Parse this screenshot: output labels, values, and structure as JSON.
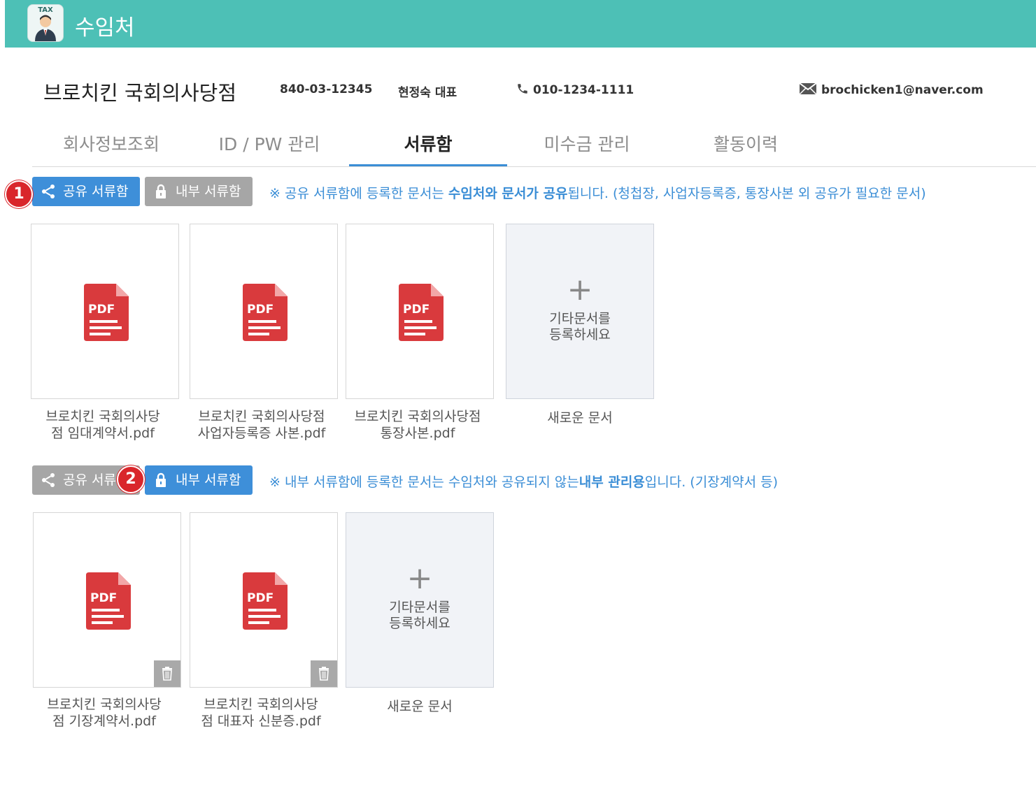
{
  "header": {
    "logo_text": "TAX",
    "title": "수임처",
    "bg_color": "#4dc0b6"
  },
  "client": {
    "company": "브로치킨 국회의사당점",
    "biz_number": "840-03-12345",
    "representative": "현정숙 대표",
    "phone": "010-1234-1111",
    "email": "brochicken1@naver.com",
    "phone_icon": "phone-icon",
    "email_icon": "envelope-icon"
  },
  "tabs": [
    {
      "label": "회사정보조회",
      "active": false
    },
    {
      "label": "ID / PW 관리",
      "active": false
    },
    {
      "label": "서류함",
      "active": true
    },
    {
      "label": "미수금 관리",
      "active": false
    },
    {
      "label": "활동이력",
      "active": false
    }
  ],
  "section1": {
    "badge": "1",
    "shared_btn": "공유 서류함",
    "internal_btn": "내부 서류함",
    "notice": {
      "p1": "※ 공유 서류함에 등록한 문서는 ",
      "b1": "수임처와 문서가 공유",
      "p2": "됩니다. (청첩장, 사업자등록증, 통장사본 외 공유가 필요한 문서)"
    },
    "files": [
      {
        "caption_l1": "브로치킨 국회의사당",
        "caption_l2": "점 임대계약서.pdf",
        "icon_label": "PDF"
      },
      {
        "caption_l1": "브로치킨 국회의사당점",
        "caption_l2": "사업자등록증 사본.pdf",
        "icon_label": "PDF"
      },
      {
        "caption_l1": "브로치킨 국회의사당점",
        "caption_l2": "통장사본.pdf",
        "icon_label": "PDF"
      }
    ],
    "new_card": {
      "plus": "+",
      "line1": "기타문서를",
      "line2": "등록하세요",
      "caption": "새로운 문서"
    }
  },
  "section2": {
    "badge": "2",
    "shared_btn": "공유 서류",
    "internal_btn": "내부 서류함",
    "notice": {
      "p1": "※ 내부 서류함에 등록한 문서는 수임처와 공유되지 않는",
      "b1": "내부 관리용",
      "p2": "입니다. (기장계약서 등)"
    },
    "files": [
      {
        "caption_l1": "브로치킨 국회의사당",
        "caption_l2": "점 기장계약서.pdf",
        "icon_label": "PDF"
      },
      {
        "caption_l1": "브로치킨 국회의사당",
        "caption_l2": "점 대표자 신분증.pdf",
        "icon_label": "PDF"
      }
    ],
    "new_card": {
      "plus": "+",
      "line1": "기타문서를",
      "line2": "등록하세요",
      "caption": "새로운 문서"
    }
  },
  "colors": {
    "accent_blue": "#3e8fd9",
    "inactive_gray": "#a6a6a6",
    "pdf_red": "#d93a3d",
    "badge_red": "#d9262b"
  }
}
